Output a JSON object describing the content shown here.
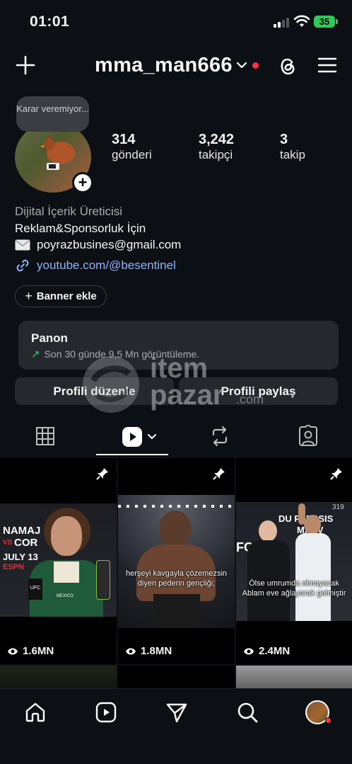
{
  "status_bar": {
    "time": "01:01",
    "battery": "35"
  },
  "header": {
    "username": "mma_man666"
  },
  "avatar": {
    "note": "Karar veremiyor..."
  },
  "stats": [
    {
      "value": "314",
      "label": "gönderi"
    },
    {
      "value": "3,242",
      "label": "takipçi"
    },
    {
      "value": "3",
      "label": "takip"
    }
  ],
  "bio": {
    "category": "Dijital İçerik Üreticisi",
    "line1": "Reklam&Sponsorluk İçin",
    "email": "poyrazbusines@gmail.com",
    "link": "youtube.com/@besentinel"
  },
  "banner_button": "Banner ekle",
  "panon": {
    "title": "Panon",
    "subtitle": "Son 30 günde 9,5 Mn görüntüleme."
  },
  "buttons": {
    "edit": "Profili düzenle",
    "share": "Profili paylaş"
  },
  "watermark": {
    "brand_top": "item",
    "brand_bottom": "pazar",
    "suffix": ".com"
  },
  "posts": [
    {
      "views": "1.6MN",
      "caption": ""
    },
    {
      "views": "1.8MN",
      "caption": "herşeyi kavgayla çözemezsin diyen pederin gençliği;"
    },
    {
      "views": "2.4MN",
      "caption": "Ölse umrumda olmayacak Ablam eve ağlayarak gelmiştir"
    }
  ],
  "thumb_text": {
    "p1_left": "NAMAJ",
    "p1_vs": "VS",
    "p1_cor": "COR",
    "p1_date": "JULY 13",
    "p1_espn": "ESPN",
    "p1_ufc": "UFC",
    "p1_mexico": "MEXICO",
    "p3_top": "DU PLESSIS",
    "p3_maev": "MAEV",
    "p3_num": "319",
    "p3_ufc": "FC"
  },
  "colors": {
    "accent_link": "#8ab4ff",
    "notification": "#ff3040",
    "battery": "#34c759",
    "growth": "#2ecc71"
  }
}
